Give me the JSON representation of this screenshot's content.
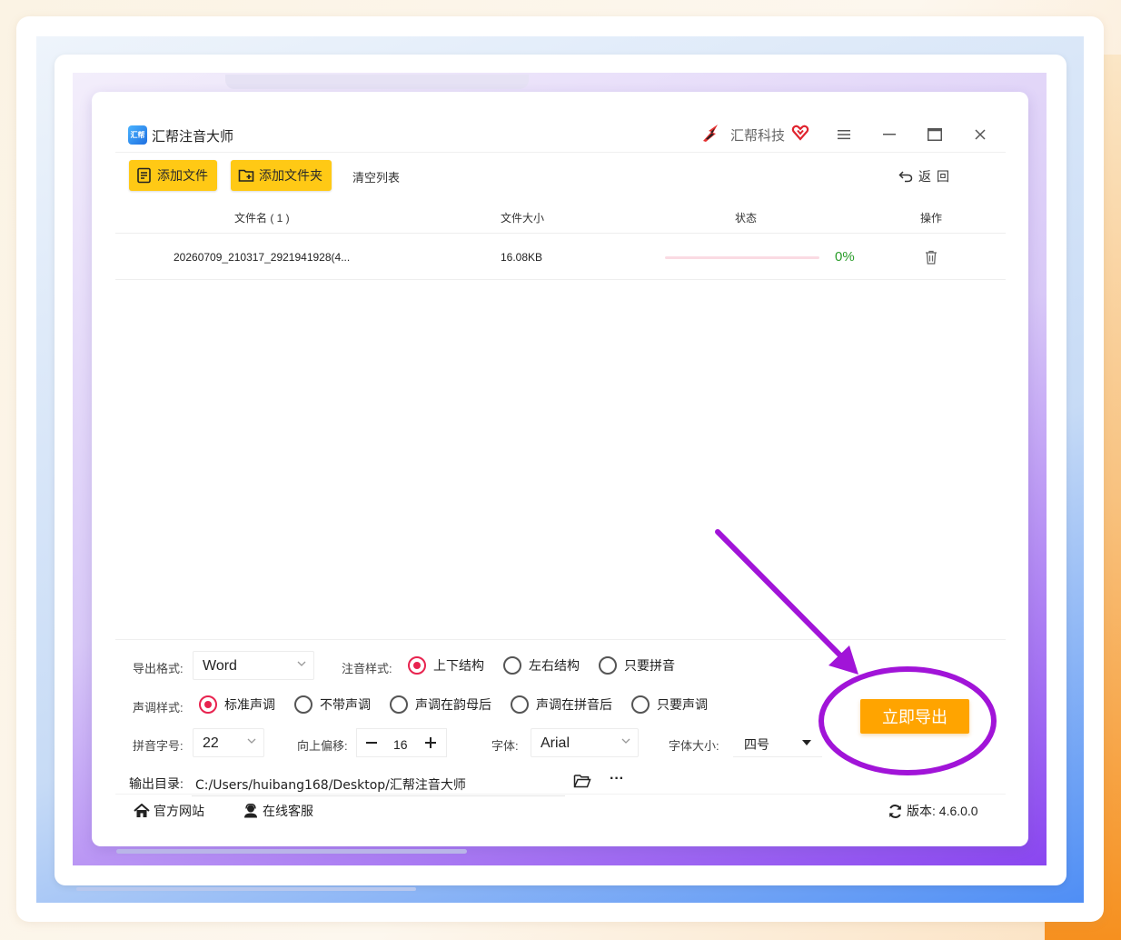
{
  "app": {
    "title": "汇帮注音大师",
    "logo_text": "汇帮",
    "brand": "汇帮科技"
  },
  "window_controls": {
    "menu": "≡",
    "minimize": "—",
    "maximize": "□",
    "close": "✕"
  },
  "toolbar": {
    "add_file": "添加文件",
    "add_folder": "添加文件夹",
    "clear_list": "清空列表",
    "back": "返回"
  },
  "table": {
    "headers": {
      "filename": "文件名 ( 1 )",
      "filesize": "文件大小",
      "status": "状态",
      "action": "操作"
    },
    "rows": [
      {
        "filename": "20260709_210317_2921941928(4...",
        "filesize": "16.08KB",
        "progress": 0,
        "progress_text": "0%"
      }
    ]
  },
  "settings": {
    "export_format_label": "导出格式:",
    "export_format_value": "Word",
    "annotation_style_label": "注音样式:",
    "annotation_styles": [
      "上下结构",
      "左右结构",
      "只要拼音"
    ],
    "annotation_style_selected": "上下结构",
    "tone_style_label": "声调样式:",
    "tone_styles": [
      "标准声调",
      "不带声调",
      "声调在韵母后",
      "声调在拼音后",
      "只要声调"
    ],
    "tone_style_selected": "标准声调",
    "pinyin_size_label": "拼音字号:",
    "pinyin_size_value": "22",
    "offset_label": "向上偏移:",
    "offset_value": "16",
    "font_label": "字体:",
    "font_value": "Arial",
    "font_size_label": "字体大小:",
    "font_size_value": "四号",
    "output_dir_label": "输出目录:",
    "output_dir_value": "C:/Users/huibang168/Desktop/汇帮注音大师",
    "more": "···"
  },
  "export_button": "立即导出",
  "footer": {
    "website": "官方网站",
    "support": "在线客服",
    "version": "版本: 4.6.0.0"
  },
  "colors": {
    "accent_yellow": "#ffc915",
    "export_orange": "#ffa400",
    "radio_checked": "#e8234f",
    "progress_green": "#2a9d2a",
    "annotation_purple": "#a114d8"
  },
  "icons": {
    "app_logo": "app-logo-icon",
    "brand": "brand-logo-icon",
    "vip": "vip-heart-icon",
    "add_file": "document-list-icon",
    "add_folder": "folder-plus-icon",
    "back": "undo-arrow-icon",
    "delete": "trash-icon",
    "folder": "folder-open-icon",
    "home": "home-icon",
    "support": "user-headset-icon",
    "refresh": "refresh-icon"
  }
}
